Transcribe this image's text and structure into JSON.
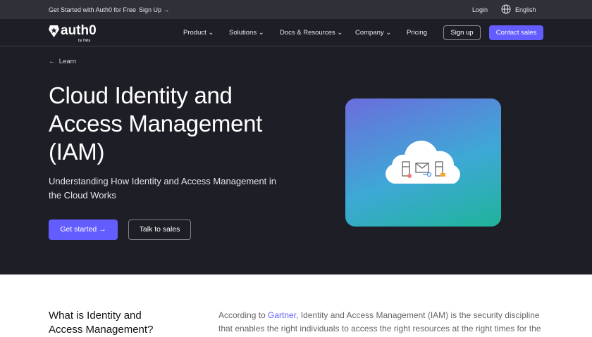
{
  "topbar": {
    "promo": "Get Started with Auth0 for Free",
    "signup": "Sign Up →",
    "login": "Login",
    "language": "English"
  },
  "nav": {
    "logo": "auth0",
    "logo_sub": "by Okta",
    "items": [
      "Product ⌄",
      "Solutions ⌄",
      "Docs & Resources ⌄",
      "Company ⌄",
      "Pricing"
    ],
    "signup": "Sign up",
    "contact": "Contact sales"
  },
  "hero": {
    "back": "Learn",
    "title": "Cloud Identity and Access Management (IAM)",
    "subtitle": "Understanding How Identity and Access Management in the Cloud Works",
    "get_started": "Get started →",
    "talk": "Talk to sales"
  },
  "section": {
    "heading": "What is Identity and Access Management?",
    "p_pre": "According to ",
    "link": "Gartner",
    "p_post": ", Identity and Access Management (IAM) is the security discipline that enables the right individuals to access the right resources at the right times for the"
  }
}
